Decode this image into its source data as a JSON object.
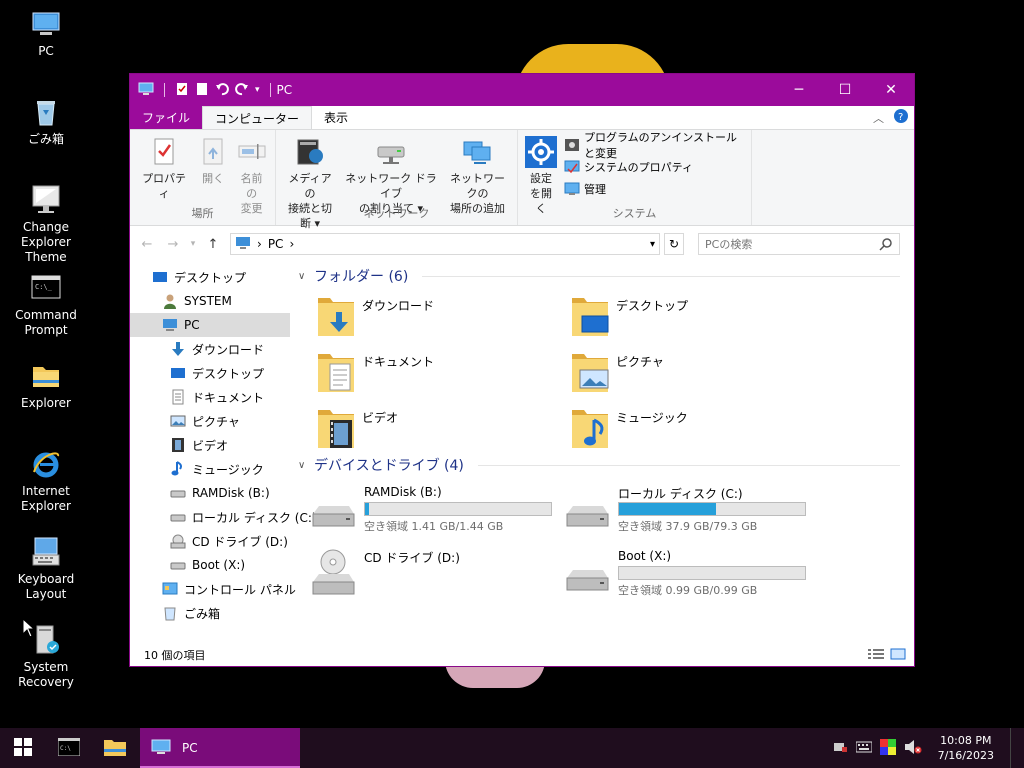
{
  "desktop": {
    "icons": [
      {
        "label": "PC",
        "icon": "pc-icon"
      },
      {
        "label": "ごみ箱",
        "icon": "recycle-bin-icon"
      },
      {
        "label": "Change Explorer Theme",
        "icon": "monitor-theme-icon"
      },
      {
        "label": "Command Prompt",
        "icon": "command-prompt-icon"
      },
      {
        "label": "Explorer",
        "icon": "folder-icon"
      },
      {
        "label": "Internet Explorer",
        "icon": "internet-explorer-icon"
      },
      {
        "label": "Keyboard Layout",
        "icon": "keyboard-icon"
      },
      {
        "label": "System Recovery",
        "icon": "system-recovery-icon"
      }
    ]
  },
  "window": {
    "title": "PC",
    "controls": {
      "minimize": "─",
      "maximize": "☐",
      "close": "✕"
    },
    "tabs": [
      {
        "label": "ファイル"
      },
      {
        "label": "コンピューター"
      },
      {
        "label": "表示"
      }
    ],
    "ribbon": {
      "groups": [
        {
          "label": "場所",
          "buttons": [
            {
              "label1": "プロパティ",
              "label2": "",
              "icon": "properties-icon"
            },
            {
              "label1": "開く",
              "label2": "",
              "icon": "open-icon"
            },
            {
              "label1": "名前の",
              "label2": "変更",
              "icon": "rename-icon"
            }
          ]
        },
        {
          "label": "ネットワーク",
          "buttons": [
            {
              "label1": "メディアの",
              "label2": "接続と切断 ▾",
              "icon": "media-access-icon"
            },
            {
              "label1": "ネットワーク ドライブ",
              "label2": "の割り当て ▾",
              "icon": "map-drive-icon"
            },
            {
              "label1": "ネットワークの",
              "label2": "場所の追加",
              "icon": "network-location-icon"
            }
          ]
        },
        {
          "label": "システム",
          "buttons": [
            {
              "label1": "設定",
              "label2": "を開く",
              "icon": "settings-gear-icon"
            }
          ],
          "small": [
            {
              "label": "プログラムのアンインストールと変更",
              "icon": "uninstall-icon"
            },
            {
              "label": "システムのプロパティ",
              "icon": "system-properties-icon"
            },
            {
              "label": "管理",
              "icon": "manage-icon"
            }
          ]
        }
      ]
    },
    "address": {
      "root_icon": "pc-icon",
      "segment": "PC",
      "sep": "›"
    },
    "search": {
      "placeholder": "PCの検索"
    },
    "nav": [
      {
        "label": "デスクトップ",
        "level": 0,
        "icon": "desktop-icon"
      },
      {
        "label": "SYSTEM",
        "level": 1,
        "icon": "user-icon"
      },
      {
        "label": "PC",
        "level": 1,
        "icon": "pc-icon",
        "selected": true
      },
      {
        "label": "ダウンロード",
        "level": 2,
        "icon": "download-icon"
      },
      {
        "label": "デスクトップ",
        "level": 2,
        "icon": "desktop-icon"
      },
      {
        "label": "ドキュメント",
        "level": 2,
        "icon": "documents-icon"
      },
      {
        "label": "ピクチャ",
        "level": 2,
        "icon": "pictures-icon"
      },
      {
        "label": "ビデオ",
        "level": 2,
        "icon": "videos-icon"
      },
      {
        "label": "ミュージック",
        "level": 2,
        "icon": "music-icon"
      },
      {
        "label": "RAMDisk (B:)",
        "level": 2,
        "icon": "drive-icon"
      },
      {
        "label": "ローカル ディスク (C:)",
        "level": 2,
        "icon": "drive-icon"
      },
      {
        "label": "CD ドライブ (D:)",
        "level": 2,
        "icon": "cd-drive-icon"
      },
      {
        "label": "Boot (X:)",
        "level": 2,
        "icon": "drive-icon"
      },
      {
        "label": "コントロール パネル",
        "level": 1,
        "icon": "control-panel-icon"
      },
      {
        "label": "ごみ箱",
        "level": 1,
        "icon": "recycle-bin-icon"
      }
    ],
    "folders_header": "フォルダー (6)",
    "folders": [
      {
        "label": "ダウンロード",
        "icon": "download-folder-icon"
      },
      {
        "label": "デスクトップ",
        "icon": "desktop-folder-icon"
      },
      {
        "label": "ドキュメント",
        "icon": "documents-folder-icon"
      },
      {
        "label": "ピクチャ",
        "icon": "pictures-folder-icon"
      },
      {
        "label": "ビデオ",
        "icon": "videos-folder-icon"
      },
      {
        "label": "ミュージック",
        "icon": "music-folder-icon"
      }
    ],
    "drives_header": "デバイスとドライブ (4)",
    "drives": [
      {
        "label": "RAMDisk (B:)",
        "free": "空き領域 1.41 GB/1.44 GB",
        "used_fraction": 0.02,
        "icon": "drive-icon"
      },
      {
        "label": "ローカル ディスク (C:)",
        "free": "空き領域 37.9 GB/79.3 GB",
        "used_fraction": 0.52,
        "icon": "drive-icon"
      },
      {
        "label": "CD ドライブ (D:)",
        "free": "",
        "used_fraction": null,
        "icon": "cd-drive-icon"
      },
      {
        "label": "Boot (X:)",
        "free": "空き領域 0.99 GB/0.99 GB",
        "used_fraction": 0.0,
        "icon": "drive-icon"
      }
    ],
    "status": "10 個の項目"
  },
  "taskbar": {
    "app_label": "PC",
    "time": "10:08 PM",
    "date": "7/16/2023"
  },
  "colors": {
    "accent": "#9b0b9b",
    "folder": "#f3c85a",
    "progress": "#26a0da"
  }
}
